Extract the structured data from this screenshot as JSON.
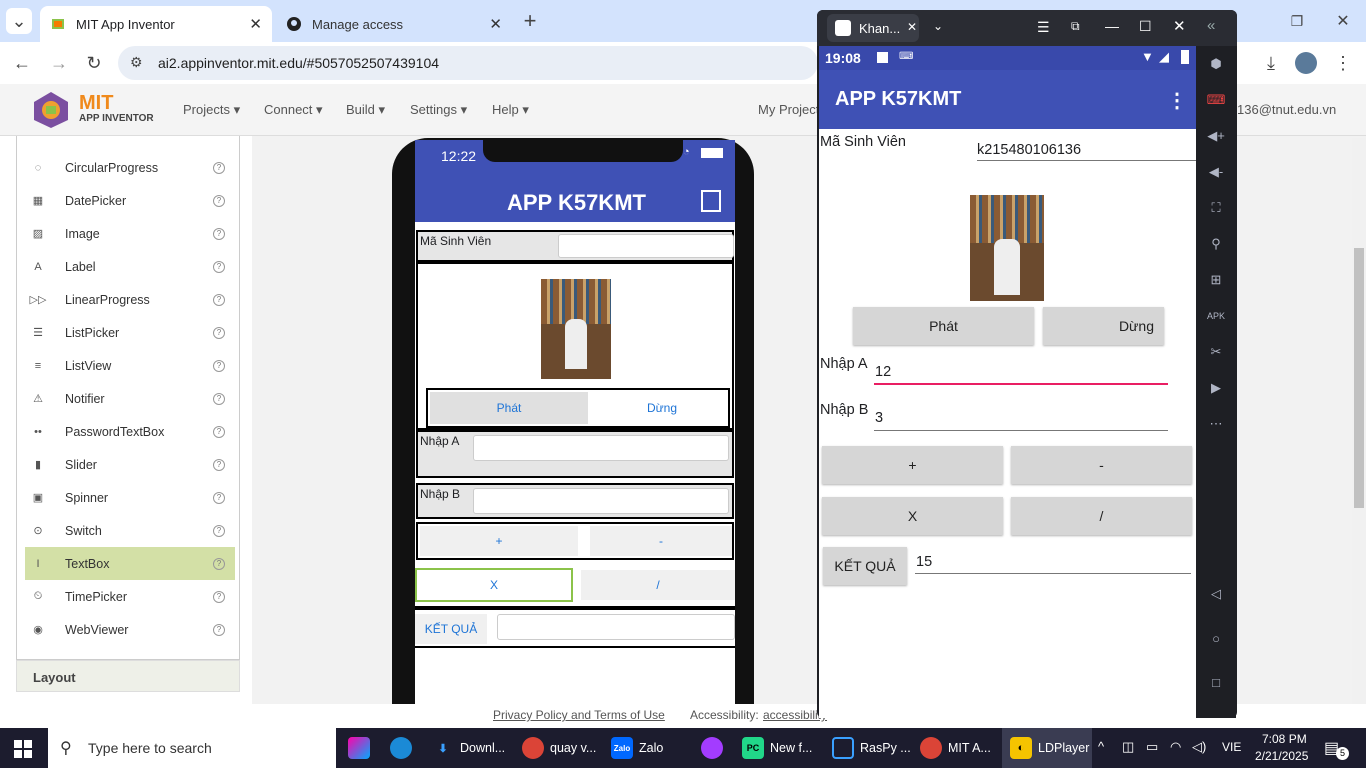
{
  "browser": {
    "tabs": [
      {
        "title": "MIT App Inventor"
      },
      {
        "title": "Manage access"
      }
    ],
    "url": "ai2.appinventor.mit.edu/#5057052507439104"
  },
  "appinventor": {
    "logo_top": "MIT",
    "logo_bottom": "APP INVENTOR",
    "menus": [
      "Projects ▾",
      "Connect ▾",
      "Build ▾",
      "Settings ▾",
      "Help ▾"
    ],
    "my_projects": "My Projects",
    "user_email_partial": "136@tnut.edu.vn",
    "palette_items": [
      {
        "label": "CircularProgress",
        "icon": "circular-progress-icon"
      },
      {
        "label": "DatePicker",
        "icon": "date-picker-icon"
      },
      {
        "label": "Image",
        "icon": "image-icon"
      },
      {
        "label": "Label",
        "icon": "label-icon"
      },
      {
        "label": "LinearProgress",
        "icon": "linear-progress-icon"
      },
      {
        "label": "ListPicker",
        "icon": "list-picker-icon"
      },
      {
        "label": "ListView",
        "icon": "list-view-icon"
      },
      {
        "label": "Notifier",
        "icon": "notifier-icon"
      },
      {
        "label": "PasswordTextBox",
        "icon": "password-icon"
      },
      {
        "label": "Slider",
        "icon": "slider-icon"
      },
      {
        "label": "Spinner",
        "icon": "spinner-icon"
      },
      {
        "label": "Switch",
        "icon": "switch-icon"
      },
      {
        "label": "TextBox",
        "icon": "textbox-icon"
      },
      {
        "label": "TimePicker",
        "icon": "time-picker-icon"
      },
      {
        "label": "WebViewer",
        "icon": "webviewer-icon"
      }
    ],
    "selected_item": "TextBox",
    "layout_section": "Layout",
    "footer_privacy": "Privacy Policy and Terms of Use",
    "footer_access_label": "Accessibility:",
    "footer_access_link": "accessibility"
  },
  "designer_phone": {
    "time": "12:22",
    "app_title": "APP K57KMT",
    "msv_label": "Mã Sinh Viên",
    "btn_play": "Phát",
    "btn_stop": "Dừng",
    "nhap_a": "Nhập A",
    "nhap_b": "Nhập B",
    "plus": "+",
    "minus": "-",
    "mul": "X",
    "div": "/",
    "ketqua": "KẾT QUẢ"
  },
  "emulator": {
    "window_title": "Khan...",
    "time": "19:08",
    "app_title": "APP K57KMT",
    "msv_label": "Mã Sinh Viên",
    "msv_value": "k215480106136",
    "btn_play": "Phát",
    "btn_stop": "Dừng",
    "nhap_a": "Nhập A",
    "a_value": "12",
    "nhap_b": "Nhập B",
    "b_value": "3",
    "plus": "+",
    "minus": "-",
    "mul": "X",
    "div": "/",
    "ketqua": "KẾT QUẢ",
    "result": "15"
  },
  "taskbar": {
    "search_placeholder": "Type here to search",
    "apps": [
      {
        "label": "Downl..."
      },
      {
        "label": "quay v..."
      },
      {
        "label": "Zalo"
      },
      {
        "label": "New f..."
      },
      {
        "label": "RasPy ..."
      },
      {
        "label": "MIT A..."
      },
      {
        "label": "LDPlayer"
      }
    ],
    "lang": "VIE",
    "time": "7:08 PM",
    "date": "2/21/2025",
    "notif_count": "5"
  }
}
